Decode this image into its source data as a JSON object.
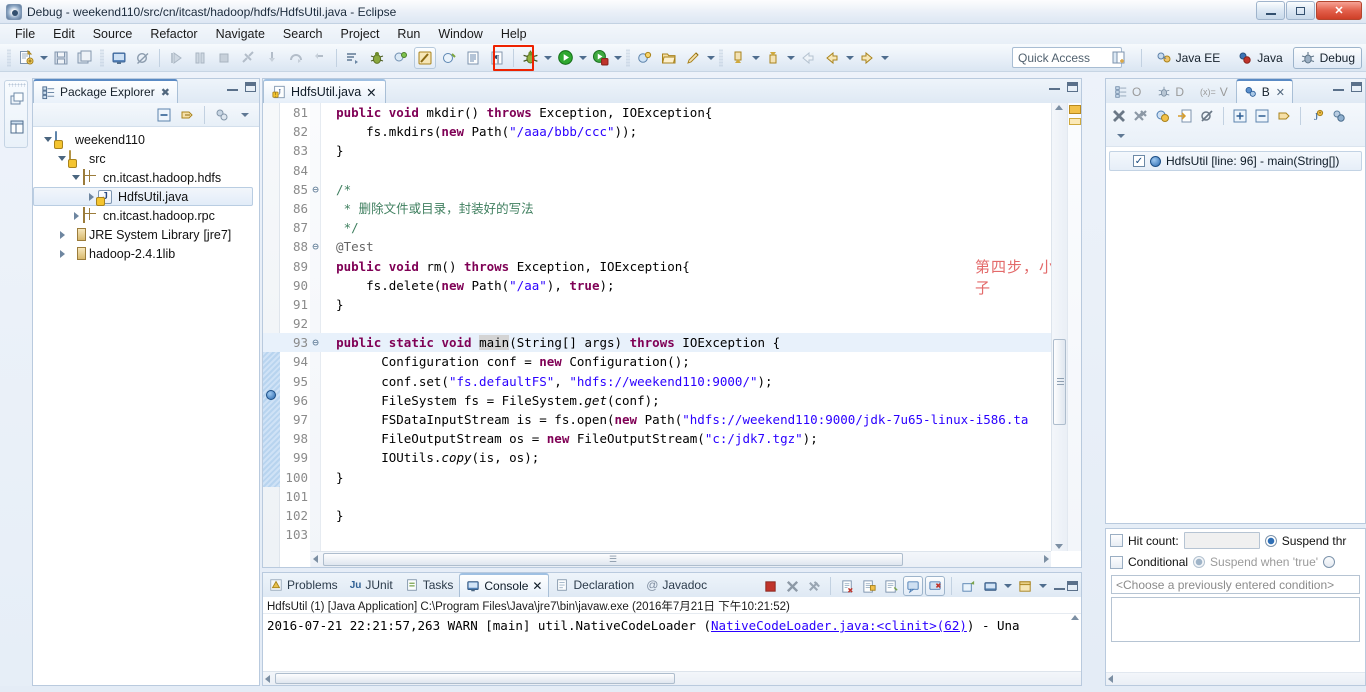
{
  "window": {
    "title": "Debug - weekend110/src/cn/itcast/hadoop/hdfs/HdfsUtil.java - Eclipse",
    "minimize_label": "–",
    "maximize_label": "❐",
    "close_label": "✕"
  },
  "menubar": {
    "items": [
      "File",
      "Edit",
      "Source",
      "Refactor",
      "Navigate",
      "Search",
      "Project",
      "Run",
      "Window",
      "Help"
    ]
  },
  "toolbar": {
    "quick_access_placeholder": "Quick Access",
    "highlighted_button": "debug-button",
    "perspectives": [
      {
        "label": "Java EE",
        "active": false
      },
      {
        "label": "Java",
        "active": false
      },
      {
        "label": "Debug",
        "active": true
      }
    ],
    "open_perspective_tooltip": "Open Perspective"
  },
  "package_explorer": {
    "tab_label": "Package Explorer",
    "tree": [
      {
        "label": "weekend110",
        "indent": 0,
        "icon": "project-icon",
        "expanded": true,
        "selected": false
      },
      {
        "label": "src",
        "indent": 1,
        "icon": "source-folder-icon",
        "expanded": true,
        "selected": false
      },
      {
        "label": "cn.itcast.hadoop.hdfs",
        "indent": 2,
        "icon": "package-icon",
        "expanded": true,
        "selected": false
      },
      {
        "label": "HdfsUtil.java",
        "indent": 3,
        "icon": "java-file-icon",
        "expanded": false,
        "selected": true
      },
      {
        "label": "cn.itcast.hadoop.rpc",
        "indent": 2,
        "icon": "package-icon",
        "expanded": false,
        "selected": false
      },
      {
        "label": "JRE System Library",
        "suffix": "[jre7]",
        "indent": 1,
        "icon": "library-icon",
        "expanded": false,
        "selected": false
      },
      {
        "label": "hadoop-2.4.1lib",
        "indent": 1,
        "icon": "library-icon",
        "expanded": false,
        "selected": false
      }
    ]
  },
  "editor": {
    "tab_label": "HdfsUtil.java",
    "tab_close": "✕",
    "annotation": "第四步，小虫子",
    "breakpoint_line": 96,
    "highlight_line": 93,
    "lines": [
      {
        "n": 81,
        "fold": "",
        "tokens": [
          {
            "t": "  ",
            "c": "plain"
          },
          {
            "t": "public",
            "c": "kw"
          },
          {
            "t": " ",
            "c": "plain"
          },
          {
            "t": "void",
            "c": "kw"
          },
          {
            "t": " mkdir() ",
            "c": "plain"
          },
          {
            "t": "throws",
            "c": "kw"
          },
          {
            "t": " Exception, IOException{",
            "c": "plain"
          }
        ]
      },
      {
        "n": 82,
        "fold": "",
        "tokens": [
          {
            "t": "      fs.mkdirs(",
            "c": "plain"
          },
          {
            "t": "new",
            "c": "kw"
          },
          {
            "t": " Path(",
            "c": "plain"
          },
          {
            "t": "\"/aaa/bbb/ccc\"",
            "c": "str"
          },
          {
            "t": "));",
            "c": "plain"
          }
        ]
      },
      {
        "n": 83,
        "fold": "",
        "tokens": [
          {
            "t": "  }",
            "c": "plain"
          }
        ]
      },
      {
        "n": 84,
        "fold": "",
        "tokens": [
          {
            "t": "",
            "c": "plain"
          }
        ]
      },
      {
        "n": 85,
        "fold": "⊖",
        "tokens": [
          {
            "t": "  /*",
            "c": "cmt"
          }
        ]
      },
      {
        "n": 86,
        "fold": "",
        "tokens": [
          {
            "t": "   * 删除文件或目录，封装好的写法",
            "c": "cmt"
          }
        ]
      },
      {
        "n": 87,
        "fold": "",
        "tokens": [
          {
            "t": "   */",
            "c": "cmt"
          }
        ]
      },
      {
        "n": 88,
        "fold": "⊖",
        "tokens": [
          {
            "t": "  @Test",
            "c": "ann"
          }
        ]
      },
      {
        "n": 89,
        "fold": "",
        "tokens": [
          {
            "t": "  ",
            "c": "plain"
          },
          {
            "t": "public",
            "c": "kw"
          },
          {
            "t": " ",
            "c": "plain"
          },
          {
            "t": "void",
            "c": "kw"
          },
          {
            "t": " rm() ",
            "c": "plain"
          },
          {
            "t": "throws",
            "c": "kw"
          },
          {
            "t": " Exception, IOException{",
            "c": "plain"
          }
        ]
      },
      {
        "n": 90,
        "fold": "",
        "tokens": [
          {
            "t": "      fs.delete(",
            "c": "plain"
          },
          {
            "t": "new",
            "c": "kw"
          },
          {
            "t": " Path(",
            "c": "plain"
          },
          {
            "t": "\"/aa\"",
            "c": "str"
          },
          {
            "t": "), ",
            "c": "plain"
          },
          {
            "t": "true",
            "c": "kw"
          },
          {
            "t": ");",
            "c": "plain"
          }
        ]
      },
      {
        "n": 91,
        "fold": "",
        "tokens": [
          {
            "t": "  }",
            "c": "plain"
          }
        ]
      },
      {
        "n": 92,
        "fold": "",
        "tokens": [
          {
            "t": "",
            "c": "plain"
          }
        ]
      },
      {
        "n": 93,
        "fold": "⊖",
        "hl": true,
        "tokens": [
          {
            "t": "  ",
            "c": "plain"
          },
          {
            "t": "public",
            "c": "kw"
          },
          {
            "t": " ",
            "c": "plain"
          },
          {
            "t": "static",
            "c": "kw"
          },
          {
            "t": " ",
            "c": "plain"
          },
          {
            "t": "void",
            "c": "kw"
          },
          {
            "t": " ",
            "c": "plain"
          },
          {
            "t": "main",
            "c": "sel-word"
          },
          {
            "t": "(String[] args) ",
            "c": "plain"
          },
          {
            "t": "throws",
            "c": "kw"
          },
          {
            "t": " IOException {",
            "c": "plain"
          }
        ]
      },
      {
        "n": 94,
        "fold": "",
        "tokens": [
          {
            "t": "        Configuration conf = ",
            "c": "plain"
          },
          {
            "t": "new",
            "c": "kw"
          },
          {
            "t": " Configuration();",
            "c": "plain"
          }
        ]
      },
      {
        "n": 95,
        "fold": "",
        "tokens": [
          {
            "t": "        conf.set(",
            "c": "plain"
          },
          {
            "t": "\"fs.defaultFS\"",
            "c": "str"
          },
          {
            "t": ", ",
            "c": "plain"
          },
          {
            "t": "\"hdfs://weekend110:9000/\"",
            "c": "str"
          },
          {
            "t": ");",
            "c": "plain"
          }
        ]
      },
      {
        "n": 96,
        "fold": "",
        "tokens": [
          {
            "t": "        FileSystem fs = FileSystem.",
            "c": "plain"
          },
          {
            "t": "get",
            "c": "stat"
          },
          {
            "t": "(conf);",
            "c": "plain"
          }
        ]
      },
      {
        "n": 97,
        "fold": "",
        "tokens": [
          {
            "t": "        FSDataInputStream is = fs.open(",
            "c": "plain"
          },
          {
            "t": "new",
            "c": "kw"
          },
          {
            "t": " Path(",
            "c": "plain"
          },
          {
            "t": "\"hdfs://weekend110:9000/jdk-7u65-linux-i586.ta",
            "c": "str"
          }
        ]
      },
      {
        "n": 98,
        "fold": "",
        "tokens": [
          {
            "t": "        FileOutputStream os = ",
            "c": "plain"
          },
          {
            "t": "new",
            "c": "kw"
          },
          {
            "t": " FileOutputStream(",
            "c": "plain"
          },
          {
            "t": "\"c:/jdk7.tgz\"",
            "c": "str"
          },
          {
            "t": ");",
            "c": "plain"
          }
        ]
      },
      {
        "n": 99,
        "fold": "",
        "tokens": [
          {
            "t": "        IOUtils.",
            "c": "plain"
          },
          {
            "t": "copy",
            "c": "stat"
          },
          {
            "t": "(is, os);",
            "c": "plain"
          }
        ]
      },
      {
        "n": 100,
        "fold": "",
        "tokens": [
          {
            "t": "  }",
            "c": "plain"
          }
        ]
      },
      {
        "n": 101,
        "fold": "",
        "tokens": [
          {
            "t": "",
            "c": "plain"
          }
        ]
      },
      {
        "n": 102,
        "fold": "",
        "tokens": [
          {
            "t": "  }",
            "c": "plain"
          }
        ]
      },
      {
        "n": 103,
        "fold": "",
        "tokens": [
          {
            "t": "",
            "c": "plain"
          }
        ]
      }
    ]
  },
  "console": {
    "tabs": [
      {
        "label": "Problems",
        "icon": "problems-icon",
        "active": false
      },
      {
        "label": "JUnit",
        "icon": "junit-icon",
        "active": false
      },
      {
        "label": "Tasks",
        "icon": "tasks-icon",
        "active": false
      },
      {
        "label": "Console",
        "icon": "console-icon",
        "active": true,
        "close": "✕"
      },
      {
        "label": "Declaration",
        "icon": "declaration-icon",
        "active": false
      },
      {
        "label": "Javadoc",
        "icon": "javadoc-icon",
        "active": false
      }
    ],
    "launch_header": "HdfsUtil (1) [Java Application] C:\\Program Files\\Java\\jre7\\bin\\javaw.exe (2016年7月21日 下午10:21:52)",
    "output_prefix": "2016-07-21 22:21:57,263 WARN  [main] util.NativeCodeLoader (",
    "output_link": "NativeCodeLoader.java:<clinit>(62)",
    "output_suffix": ") - Una"
  },
  "breakpoints_view": {
    "tabs": [
      {
        "label": "O",
        "icon": "outline-icon",
        "active": false
      },
      {
        "label": "D",
        "icon": "debug-icon",
        "active": false
      },
      {
        "label": "V",
        "icon": "variables-icon",
        "active": false
      },
      {
        "label": "B",
        "icon": "breakpoints-icon",
        "active": true,
        "close": "✕"
      }
    ],
    "items": [
      {
        "checked": true,
        "label": "HdfsUtil [line: 96] - main(String[])"
      }
    ]
  },
  "breakpoint_properties": {
    "hit_count_label": "Hit count:",
    "hit_count_value": "",
    "hit_count_checked": false,
    "suspend_thread_label": "Suspend thr",
    "suspend_thread_selected": true,
    "conditional_label": "Conditional",
    "conditional_checked": false,
    "suspend_when_true_label": "Suspend when 'true'",
    "condition_placeholder": "<Choose a previously entered condition>"
  }
}
